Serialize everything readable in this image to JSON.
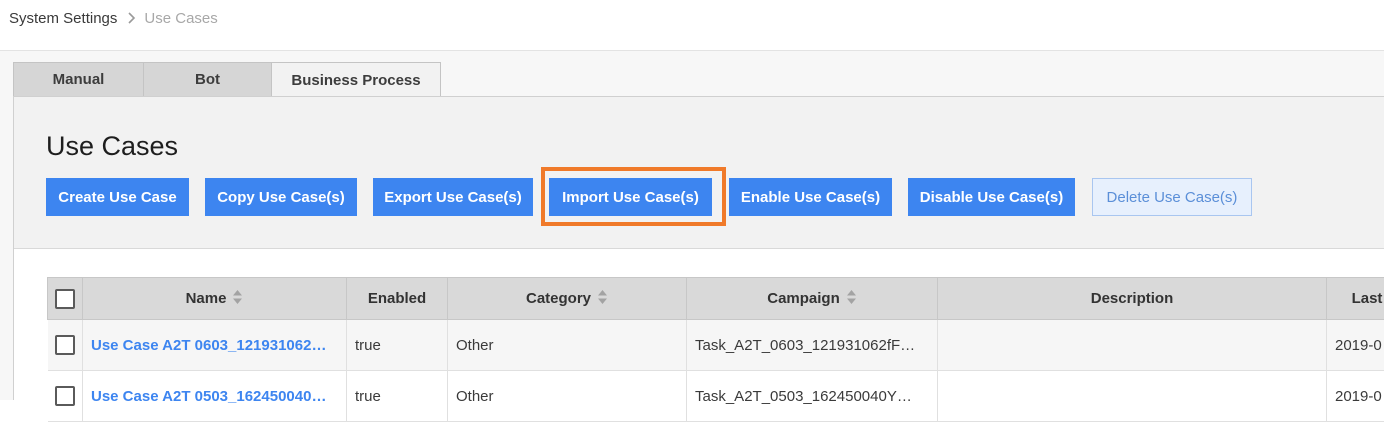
{
  "breadcrumb": {
    "parent": "System Settings",
    "current": "Use Cases",
    "separator_icon": "chevron-right-icon"
  },
  "tabs": [
    {
      "label": "Manual",
      "active": false
    },
    {
      "label": "Bot",
      "active": false
    },
    {
      "label": "Business Process",
      "active": true
    }
  ],
  "page": {
    "title": "Use Cases"
  },
  "toolbar": {
    "create": "Create Use Case",
    "copy": "Copy Use Case(s)",
    "export": "Export Use Case(s)",
    "import": "Import Use Case(s)",
    "enable": "Enable Use Case(s)",
    "disable": "Disable Use Case(s)",
    "delete": "Delete Use Case(s)"
  },
  "colors": {
    "primary_button": "#3d85f0",
    "highlight": "#f07a2a",
    "link": "#3d85f0"
  },
  "table": {
    "columns": {
      "name": "Name",
      "enabled": "Enabled",
      "category": "Category",
      "campaign": "Campaign",
      "description": "Description",
      "last": "Last"
    },
    "rows": [
      {
        "name": "Use Case A2T 0603_121931062…",
        "enabled": "true",
        "category": "Other",
        "campaign": "Task_A2T_0603_121931062fF…",
        "description": "",
        "last": "2019-0"
      },
      {
        "name": "Use Case A2T 0503_162450040…",
        "enabled": "true",
        "category": "Other",
        "campaign": "Task_A2T_0503_162450040Y…",
        "description": "",
        "last": "2019-0"
      }
    ]
  }
}
